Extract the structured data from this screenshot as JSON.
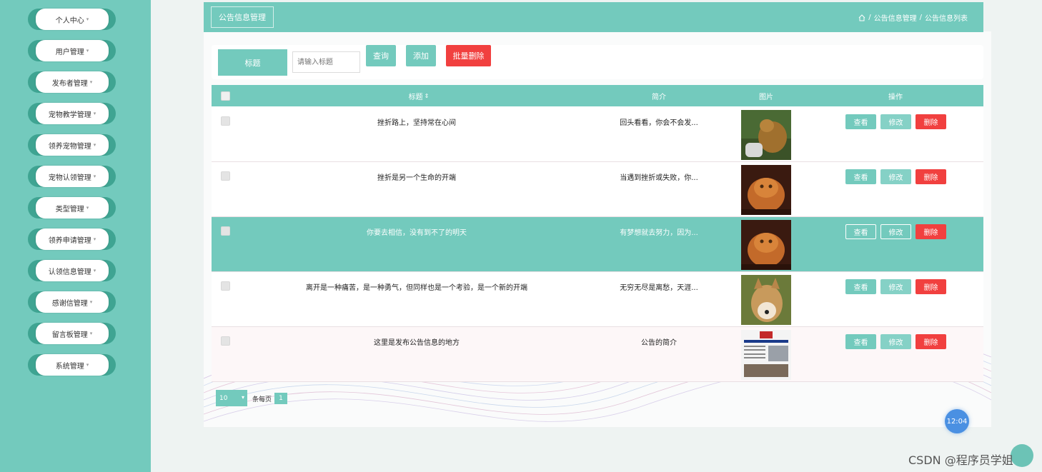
{
  "sidebar": {
    "items": [
      {
        "label": "个人中心"
      },
      {
        "label": "用户管理"
      },
      {
        "label": "发布者管理"
      },
      {
        "label": "宠物教学管理"
      },
      {
        "label": "领养宠物管理"
      },
      {
        "label": "宠物认领管理"
      },
      {
        "label": "类型管理"
      },
      {
        "label": "领养申请管理"
      },
      {
        "label": "认领信息管理"
      },
      {
        "label": "感谢信管理"
      },
      {
        "label": "留言板管理"
      },
      {
        "label": "系统管理"
      }
    ],
    "caret": "▾"
  },
  "header": {
    "title": "公告信息管理",
    "breadcrumb": {
      "home_icon": "home-icon",
      "sep": "/",
      "level1": "公告信息管理",
      "level2": "公告信息列表"
    }
  },
  "search": {
    "label": "标题",
    "placeholder": "请输入标题",
    "query_button": "查询",
    "add_button": "添加",
    "batch_delete_button": "批量删除"
  },
  "table": {
    "columns": [
      "标题",
      "简介",
      "图片",
      "操作"
    ],
    "sort_icon": "⇕",
    "actions": {
      "view": "查看",
      "edit": "修改",
      "delete": "删除"
    },
    "rows": [
      {
        "title": "挫折路上，坚持常在心间",
        "intro": "回头看看，你会不会发...",
        "image": "cat-photo"
      },
      {
        "title": "挫折是另一个生命的开端",
        "intro": "当遇到挫折或失败，你...",
        "image": "persian-cat-photo"
      },
      {
        "title": "你要去相信，没有到不了的明天",
        "intro": "有梦想就去努力，因为...",
        "image": "persian-cat-photo"
      },
      {
        "title": "离开是一种痛苦，是一种勇气，但同样也是一个考验，是一个新的开端",
        "intro": "无穷无尽是离愁，天涯...",
        "image": "dog-photo"
      },
      {
        "title": "这里是发布公告信息的地方",
        "intro": "公告的简介",
        "image": "newspaper-photo"
      }
    ],
    "highlighted_row": 2
  },
  "pager": {
    "page_size": "10",
    "per_page_label": "条每页",
    "current_page": "1"
  },
  "clock": "12:04",
  "watermark": "CSDN @程序员学姐",
  "colors": {
    "accent": "#73cabd",
    "danger": "#f1403f",
    "sidebar_bg": "#73cabd"
  }
}
